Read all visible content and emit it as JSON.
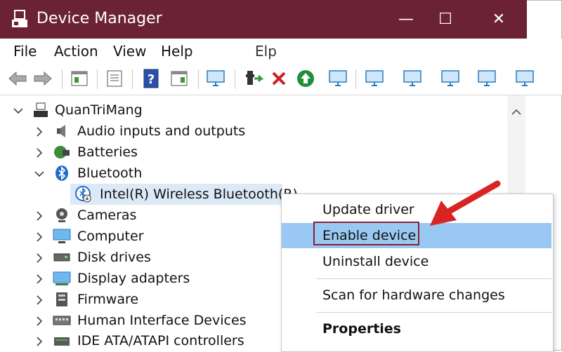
{
  "window": {
    "title": "Device Manager",
    "buttons": {
      "minimize": "—",
      "maximize": "☐",
      "close": "✕"
    }
  },
  "menubar": {
    "items": [
      "File",
      "Action",
      "View",
      "Help"
    ],
    "ghost_text": "Elp"
  },
  "toolbar": {
    "icons": [
      "back-icon",
      "forward-icon",
      "properties-pane-icon",
      "list-view-icon",
      "help-icon",
      "show-hidden-icon",
      "monitor-icon",
      "update-driver-icon",
      "uninstall-icon",
      "enable-icon",
      "monitor-icon",
      "monitor-icon",
      "monitor-icon",
      "monitor-icon",
      "monitor-icon",
      "monitor-icon"
    ]
  },
  "tree": {
    "root": "QuanTriMang",
    "categories": [
      {
        "label": "Audio inputs and outputs",
        "icon": "speaker-icon"
      },
      {
        "label": "Batteries",
        "icon": "battery-icon"
      },
      {
        "label": "Bluetooth",
        "icon": "bluetooth-icon",
        "expanded": true
      },
      {
        "label": "Intel(R) Wireless Bluetooth(R)",
        "icon": "bluetooth-disabled-icon",
        "child": true
      },
      {
        "label": "Cameras",
        "icon": "camera-icon"
      },
      {
        "label": "Computer",
        "icon": "computer-icon"
      },
      {
        "label": "Disk drives",
        "icon": "disk-icon"
      },
      {
        "label": "Display adapters",
        "icon": "display-adapter-icon"
      },
      {
        "label": "Firmware",
        "icon": "firmware-icon"
      },
      {
        "label": "Human Interface Devices",
        "icon": "hid-icon"
      },
      {
        "label": "IDE ATA/ATAPI controllers",
        "icon": "ide-icon"
      }
    ]
  },
  "context_menu": {
    "items": [
      "Update driver",
      "Enable device",
      "Uninstall device",
      "Scan for hardware changes",
      "Properties"
    ],
    "highlighted": "Enable device"
  },
  "colors": {
    "titlebar": "#6b2333",
    "highlight": "#99c9f2",
    "annotation_arrow": "#d92424",
    "annotation_box": "#8a1f2d"
  }
}
